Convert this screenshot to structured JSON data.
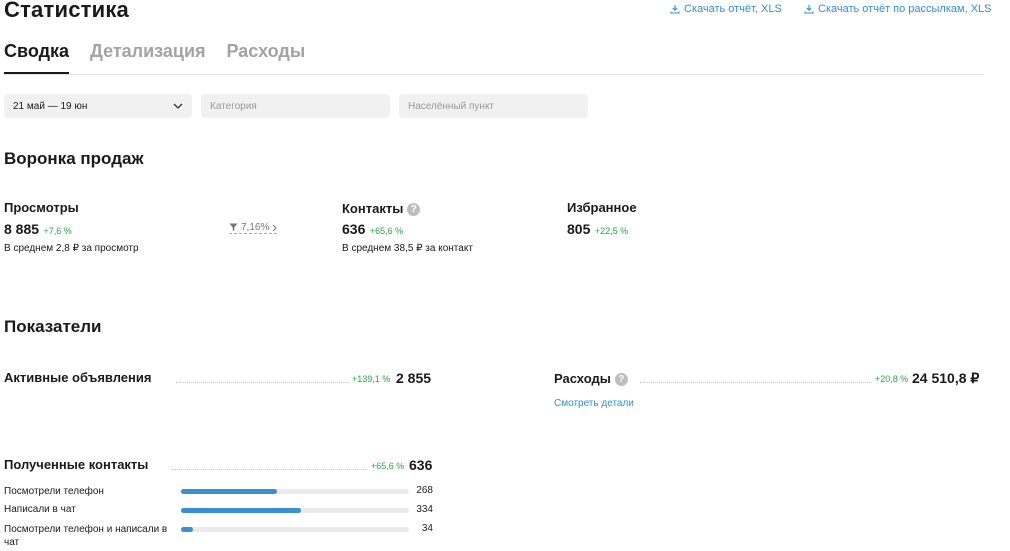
{
  "page": {
    "title": "Статистика"
  },
  "downloads": {
    "report": "Скачать отчёт, XLS",
    "mailings": "Скачать отчёт по рассылкам, XLS"
  },
  "tabs": [
    {
      "label": "Сводка",
      "active": true
    },
    {
      "label": "Детализация",
      "active": false
    },
    {
      "label": "Расходы",
      "active": false
    }
  ],
  "filters": {
    "period": "21 май — 19 юн",
    "category_placeholder": "Категория",
    "city_placeholder": "Населённый пункт"
  },
  "funnel": {
    "title": "Воронка продаж",
    "views": {
      "label": "Просмотры",
      "value": "8 885",
      "delta": "+7,6 %",
      "note": "В среднем 2,8 ₽ за просмотр"
    },
    "conversion": "7,16%",
    "contacts": {
      "label": "Контакты",
      "value": "636",
      "delta": "+65,6 %",
      "note": "В среднем 38,5 ₽ за контакт"
    },
    "favorites": {
      "label": "Избранное",
      "value": "805",
      "delta": "+22,5 %"
    }
  },
  "indicators": {
    "title": "Показатели",
    "active_ads": {
      "label": "Активные объявления",
      "delta": "+139,1 %",
      "value": "2 855"
    },
    "expenses": {
      "label": "Расходы",
      "delta": "+20,8 %",
      "value": "24 510,8 ₽",
      "link": "Смотреть детали"
    },
    "received_contacts": {
      "label": "Полученные контакты",
      "delta": "+65,6 %",
      "value": "636",
      "rows": [
        {
          "label": "Посмотрели телефон",
          "value": "268",
          "share": 0.421
        },
        {
          "label": "Написали в чат",
          "value": "334",
          "share": 0.525
        },
        {
          "label": "Посмотрели телефон и написали в чат",
          "value": "34",
          "share": 0.053
        }
      ]
    }
  },
  "colors": {
    "accent": "#2f8fd8",
    "positive": "#28a745",
    "bar": "#3a8fd0"
  }
}
